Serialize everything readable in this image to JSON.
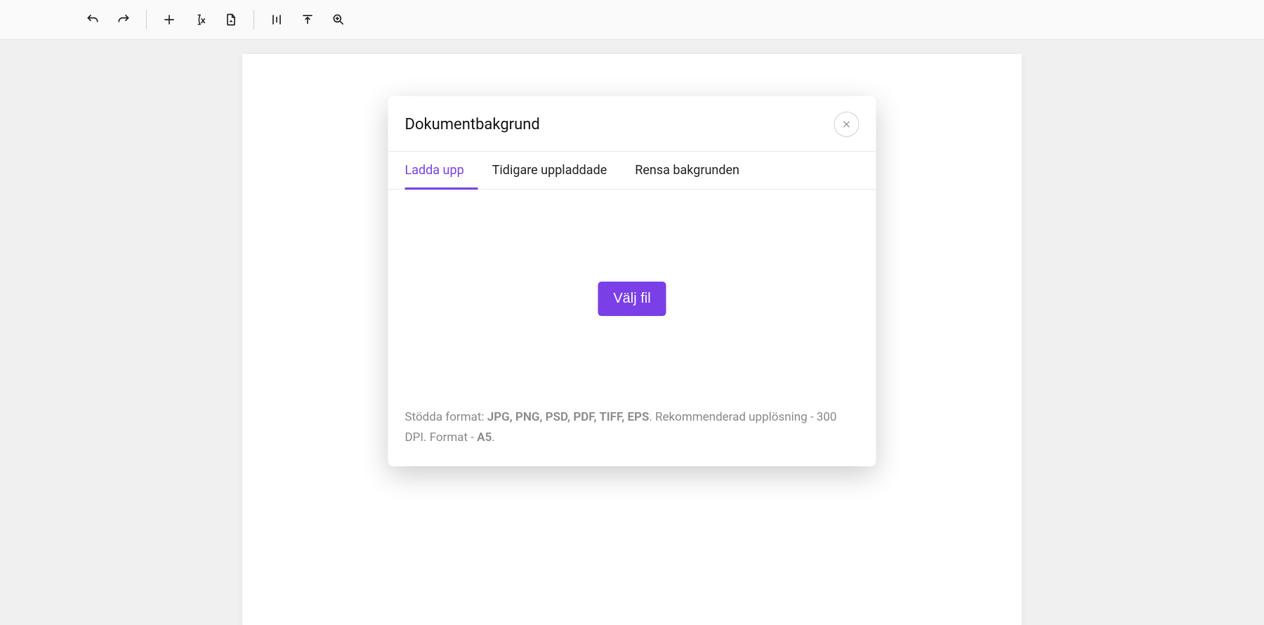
{
  "modal": {
    "title": "Dokumentbakgrund",
    "tabs": {
      "upload": "Ladda upp",
      "previous": "Tidigare uppladdade",
      "clear": "Rensa bakgrunden"
    },
    "choose_file_label": "Välj fil",
    "footer": {
      "supported_prefix": "Stödda format: ",
      "supported_formats": "JPG, PNG, PSD, PDF, TIFF, EPS",
      "resolution_text": ". Rekommenderad upplösning - 300 DPI. Format - ",
      "page_format": "A5",
      "suffix": "."
    }
  }
}
